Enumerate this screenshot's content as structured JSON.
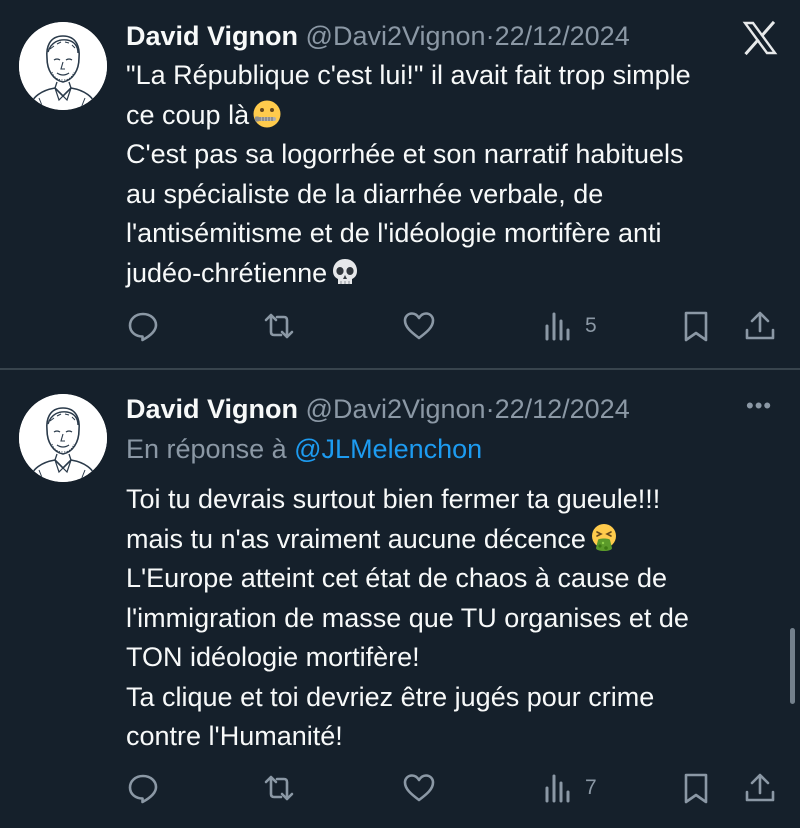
{
  "tweets": [
    {
      "name": "David Vignon",
      "handle": "@Davi2Vignon",
      "separator": "·",
      "date": "22/12/2024",
      "lines": [
        "\"La République c'est lui!\" il avait fait trop simple",
        "ce coup là",
        "C'est pas sa logorrhée et son narratif habituels",
        "au spécialiste de la diarrhée verbale, de",
        "l'antisémitisme et de l'idéologie mortifère anti",
        "judéo-chrétienne"
      ],
      "emojis": [
        "zipper-mouth-face",
        "skull"
      ],
      "views": "5"
    },
    {
      "name": "David Vignon",
      "handle": "@Davi2Vignon",
      "separator": "·",
      "date": "22/12/2024",
      "reply_prefix": "En réponse à",
      "reply_to": "@JLMelenchon",
      "lines": [
        "Toi tu devrais surtout bien fermer ta gueule!!!",
        "mais tu n'as vraiment aucune décence",
        "L'Europe atteint cet état de chaos à cause de",
        "l'immigration de masse que TU organises et de",
        "TON idéologie mortifère!",
        "Ta clique et toi devriez être jugés pour crime",
        "contre l'Humanité!"
      ],
      "emojis": [
        "vomiting-face"
      ],
      "views": "7"
    }
  ],
  "icons": {
    "top_right_first": "x-logo-icon",
    "top_right_second": "more-options-icon",
    "actions": [
      "reply-icon",
      "retweet-icon",
      "like-icon",
      "views-icon",
      "bookmark-icon",
      "share-icon"
    ]
  },
  "colors": {
    "background": "#15202b",
    "text": "#f7f9f9",
    "secondary": "#8b98a5",
    "link": "#1d9bf0",
    "divider": "#38444d"
  }
}
